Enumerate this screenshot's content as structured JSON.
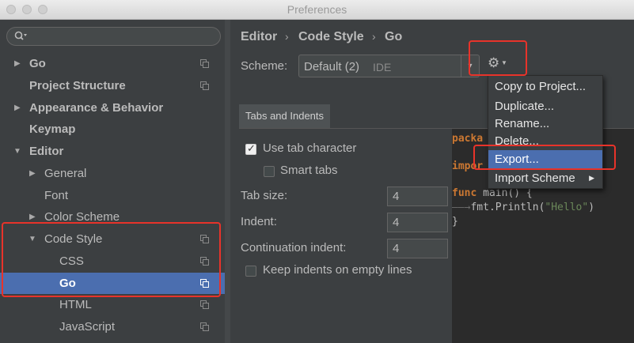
{
  "window": {
    "title": "Preferences"
  },
  "search": {
    "placeholder": ""
  },
  "tree": {
    "items": [
      {
        "label": "Go",
        "arrow": "▶"
      },
      {
        "label": "Project Structure"
      },
      {
        "label": "Appearance & Behavior",
        "arrow": "▶"
      },
      {
        "label": "Keymap"
      },
      {
        "label": "Editor",
        "arrow": "▼"
      },
      {
        "label": "General",
        "arrow": "▶"
      },
      {
        "label": "Font"
      },
      {
        "label": "Color Scheme",
        "arrow": "▶"
      },
      {
        "label": "Code Style",
        "arrow": "▼"
      },
      {
        "label": "CSS"
      },
      {
        "label": "Go",
        "selected": true
      },
      {
        "label": "HTML"
      },
      {
        "label": "JavaScript"
      }
    ]
  },
  "breadcrumb": {
    "items": [
      "Editor",
      "Code Style",
      "Go"
    ],
    "separator": "›"
  },
  "scheme": {
    "label": "Scheme:",
    "value": "Default (2)",
    "tag": "IDE"
  },
  "tabs": [
    {
      "label": "Tabs and Indents"
    }
  ],
  "options": {
    "use_tab_character": {
      "label": "Use tab character",
      "checked": true
    },
    "smart_tabs": {
      "label": "Smart tabs",
      "checked": false
    },
    "tab_size": {
      "label": "Tab size:",
      "value": "4"
    },
    "indent": {
      "label": "Indent:",
      "value": "4"
    },
    "continuation_indent": {
      "label": "Continuation indent:",
      "value": "4"
    },
    "keep_indents": {
      "label": "Keep indents on empty lines",
      "checked": false
    }
  },
  "code_preview": {
    "package_kw": "packa",
    "import_kw": "impor",
    "func_kw": "func",
    "func_sig": " main() {",
    "tab_arrow": "——→",
    "call": "fmt.Println(",
    "string": "\"Hello\"",
    "call_end": ")",
    "close": "}"
  },
  "gear_menu": {
    "items": [
      {
        "label": "Copy to Project..."
      },
      {
        "label": "Duplicate..."
      },
      {
        "label": "Rename..."
      },
      {
        "label": "Delete..."
      },
      {
        "label": "Export...",
        "highlighted": true
      },
      {
        "label": "Import Scheme",
        "submenu_arrow": "▶"
      }
    ]
  },
  "icons": {
    "search": "search-icon",
    "gear": "gear-icon",
    "copy": "copy-icon"
  },
  "colors": {
    "selection": "#4b6eaf",
    "highlight_box": "#e8332a",
    "keyword": "#cc7832",
    "string": "#6a8759"
  }
}
